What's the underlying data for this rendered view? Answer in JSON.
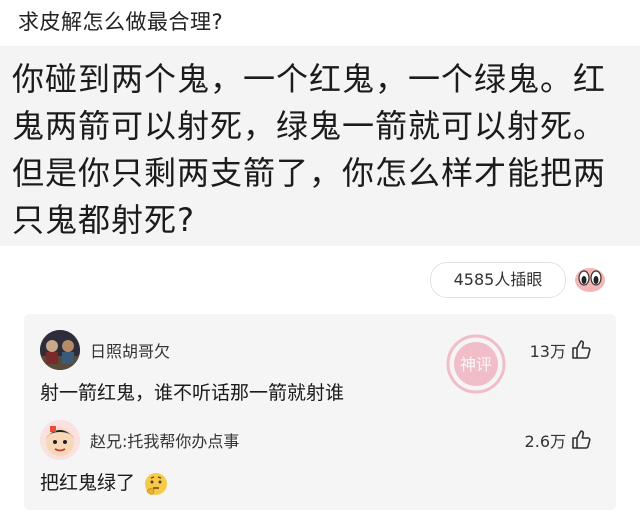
{
  "post": {
    "title": "求皮解怎么做最合理?",
    "quote": "你碰到两个鬼，一个红鬼，一个绿鬼。红鬼两箭可以射死，绿鬼一箭就可以射死。但是你只剩两支箭了，你怎么样才能把两只鬼都射死?"
  },
  "reactions": {
    "count_label": "4585人插眼",
    "icon": "eyes-emoji-icon"
  },
  "comments": [
    {
      "username": "日照胡哥欠",
      "likes": "13万",
      "text": "射一箭红鬼，谁不听话那一箭就射谁",
      "badge": "神评",
      "badge_color": "#e8567a"
    },
    {
      "username": "赵兄:托我帮你办点事",
      "likes": "2.6万",
      "text": "把红鬼绿了",
      "emoji": "thinking-face-icon"
    }
  ],
  "colors": {
    "quote_bg": "#f4f4f4",
    "comment_bg": "#f5f5f5",
    "accent": "#e8567a"
  }
}
